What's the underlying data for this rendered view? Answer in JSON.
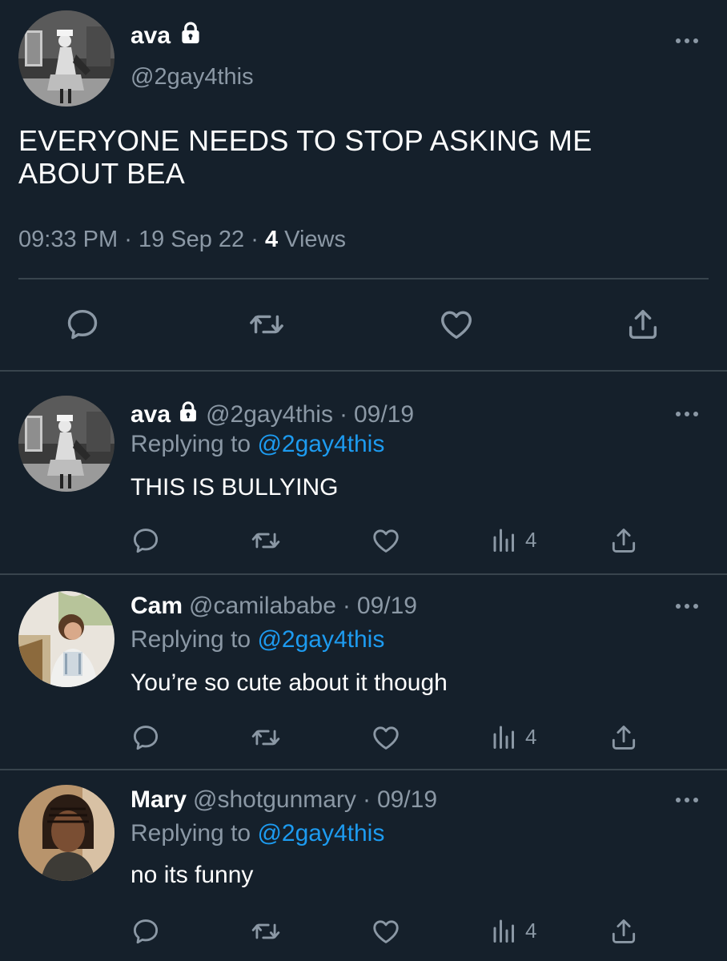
{
  "main_tweet": {
    "display_name": "ava",
    "handle": "@2gay4this",
    "text": "EVERYONE NEEDS TO STOP ASKING ME ABOUT BEA",
    "time": "09:33 PM",
    "date": "19 Sep 22",
    "views_count": "4",
    "views_label": "Views",
    "avatar": "avatar-ava"
  },
  "replies": [
    {
      "display_name": "ava",
      "handle": "@2gay4this",
      "date": "09/19",
      "replying_prefix": "Replying to",
      "replying_to": "@2gay4this",
      "text": "THIS IS BULLYING",
      "views": "4",
      "locked": true
    },
    {
      "display_name": "Cam",
      "handle": "@camilababe",
      "date": "09/19",
      "replying_prefix": "Replying to",
      "replying_to": "@2gay4this",
      "text": "You’re so cute about it though",
      "views": "4",
      "locked": false
    },
    {
      "display_name": "Mary",
      "handle": "@shotgunmary",
      "date": "09/19",
      "replying_prefix": "Replying to",
      "replying_to": "@2gay4this",
      "text": "no its funny",
      "views": "4",
      "locked": false
    }
  ],
  "separator": "·",
  "icons": [
    "lock-icon",
    "more-icon",
    "reply-icon",
    "retweet-icon",
    "like-icon",
    "views-icon",
    "share-icon"
  ],
  "colors": {
    "background": "#15202b",
    "text": "#ffffff",
    "muted": "#8b98a5",
    "mention": "#1d9bf0",
    "divider": "#38444d"
  }
}
